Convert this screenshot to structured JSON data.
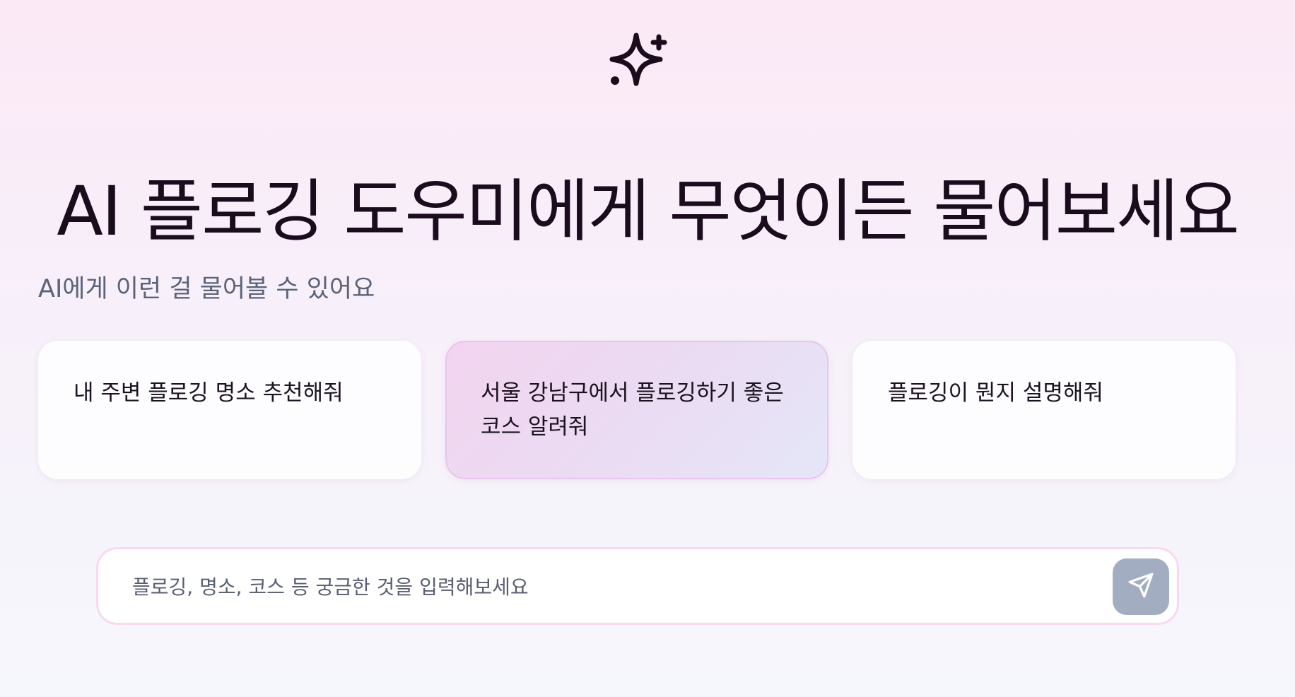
{
  "header": {
    "logo_icon": "sparkles-icon",
    "title": "AI 플로깅 도우미에게 무엇이든 물어보세요"
  },
  "suggestions": {
    "title": "AI에게 이런 걸 물어볼 수 있어요",
    "items": [
      {
        "label": "내 주변 플로깅 명소 추천해줘"
      },
      {
        "label": "서울 강남구에서 플로깅하기 좋은 코스 알려줘"
      },
      {
        "label": "플로깅이 뭔지 설명해줘"
      }
    ]
  },
  "chat_input": {
    "value": "",
    "placeholder": "플로깅, 명소, 코스 등 궁금한 것을 입력해보세요",
    "send_icon": "send-icon"
  },
  "colors": {
    "accent_highlight": "#eadcf3",
    "send_button": "#a3adc2",
    "input_border": "#f8d9ef"
  }
}
